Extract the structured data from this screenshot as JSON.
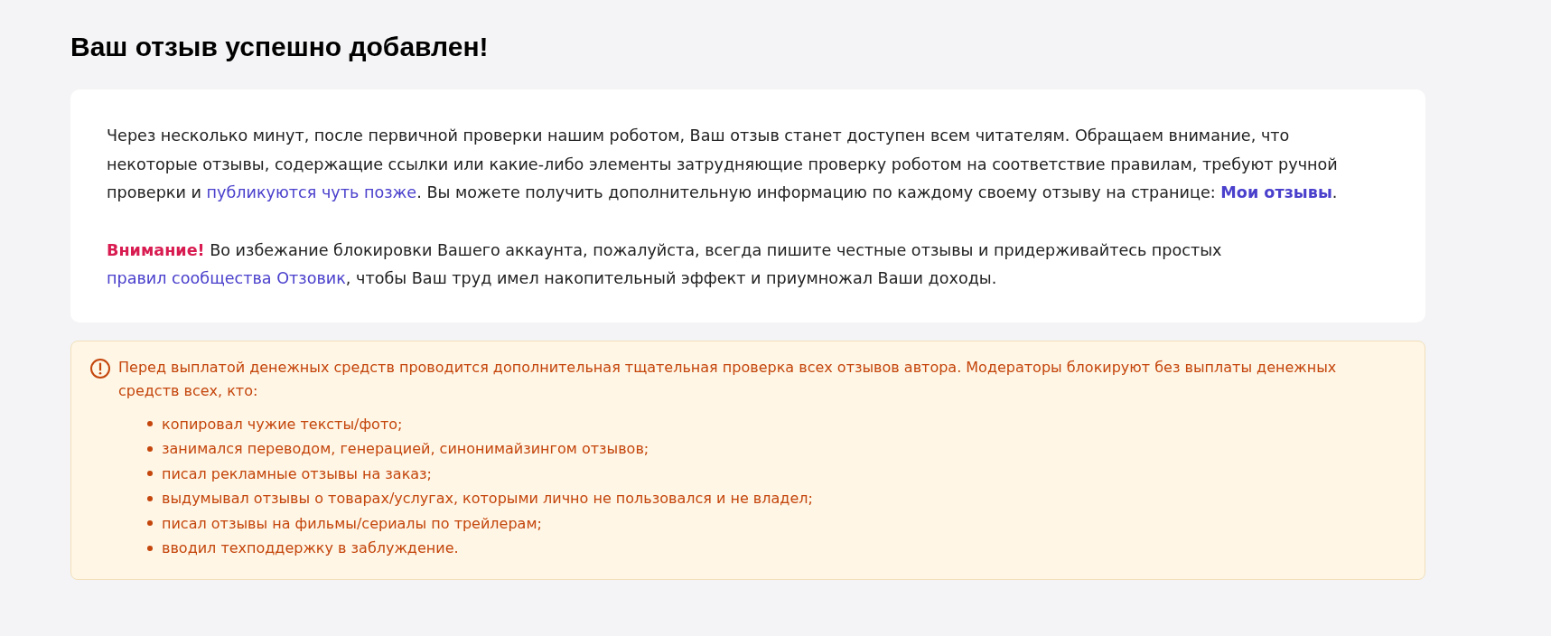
{
  "title": "Ваш отзыв успешно добавлен!",
  "card": {
    "paragraphs": [
      [
        {
          "kind": "text",
          "text": "Через несколько минут, после первичной проверки нашим роботом, Ваш отзыв станет доступен всем читателям. Обращаем внимание, что некоторые отзывы, содержащие ссылки или какие-либо элементы затрудняющие проверку роботом на соответствие правилам, требуют ручной проверки и "
        },
        {
          "kind": "link",
          "text": "публикуются чуть позже"
        },
        {
          "kind": "text",
          "text": ". Вы можете получить дополнительную информацию по каждому своему отзыву на странице: "
        },
        {
          "kind": "strong_link",
          "text": "Мои отзывы"
        },
        {
          "kind": "text",
          "text": "."
        }
      ],
      [
        {
          "kind": "alert",
          "text": "Внимание!"
        },
        {
          "kind": "text",
          "text": " Во избежание блокировки Вашего аккаунта, пожалуйста, всегда пишите честные отзывы и придерживайтесь простых "
        },
        {
          "kind": "link",
          "text": "правил сообщества Отзовик"
        },
        {
          "kind": "text",
          "text": ", чтобы Ваш труд имел накопительный эффект и приумножал Ваши доходы."
        }
      ]
    ]
  },
  "notice": {
    "text": "Перед выплатой денежных средств проводится дополнительная тщательная проверка всех отзывов автора. Модераторы блокируют без выплаты денежных средств всех, кто:",
    "items": [
      "копировал чужие тексты/фото;",
      "занимался переводом, генерацией, синонимайзингом отзывов;",
      "писал рекламные отзывы на заказ;",
      "выдумывал отзывы о товарах/услугах, которыми лично не пользовался и не владел;",
      "писал отзывы на фильмы/сериалы по трейлерам;",
      "вводил техподдержку в заблуждение."
    ]
  }
}
